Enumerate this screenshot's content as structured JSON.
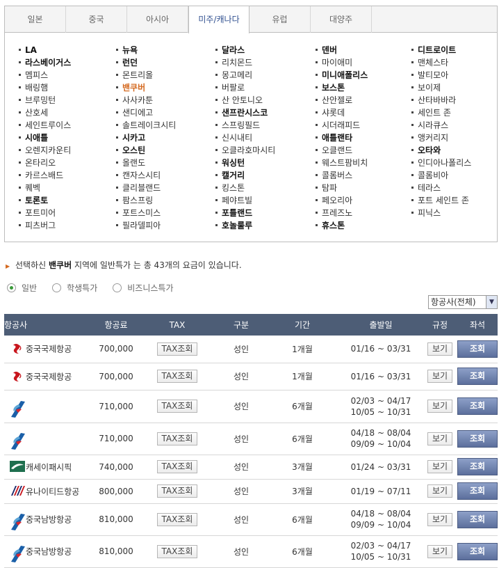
{
  "tabs": [
    {
      "label": "일본"
    },
    {
      "label": "중국"
    },
    {
      "label": "아시아"
    },
    {
      "label": "미주/캐나다"
    },
    {
      "label": "유럽"
    },
    {
      "label": "대양주"
    }
  ],
  "active_tab": 3,
  "city_columns": [
    [
      {
        "name": "LA",
        "style": "bold"
      },
      {
        "name": "라스베이거스",
        "style": "bold"
      },
      {
        "name": "멤피스",
        "style": ""
      },
      {
        "name": "배링햄",
        "style": ""
      },
      {
        "name": "브루밍턴",
        "style": ""
      },
      {
        "name": "산호세",
        "style": ""
      },
      {
        "name": "세인트루이스",
        "style": ""
      },
      {
        "name": "시애틀",
        "style": "bold"
      },
      {
        "name": "오렌지카운티",
        "style": ""
      },
      {
        "name": "온타리오",
        "style": ""
      },
      {
        "name": "카르스배드",
        "style": ""
      },
      {
        "name": "퀘벡",
        "style": ""
      },
      {
        "name": "토론토",
        "style": "bold"
      },
      {
        "name": "포트미어",
        "style": ""
      },
      {
        "name": "피츠버그",
        "style": ""
      }
    ],
    [
      {
        "name": "뉴욕",
        "style": "bold"
      },
      {
        "name": "런던",
        "style": "bold"
      },
      {
        "name": "몬트리올",
        "style": ""
      },
      {
        "name": "밴쿠버",
        "style": "sel"
      },
      {
        "name": "사사카툰",
        "style": ""
      },
      {
        "name": "샌디에고",
        "style": ""
      },
      {
        "name": "솔트레이크시티",
        "style": ""
      },
      {
        "name": "시카고",
        "style": "bold"
      },
      {
        "name": "오스틴",
        "style": "bold"
      },
      {
        "name": "올랜도",
        "style": ""
      },
      {
        "name": "캔자스시티",
        "style": ""
      },
      {
        "name": "클리블랜드",
        "style": ""
      },
      {
        "name": "팜스프링",
        "style": ""
      },
      {
        "name": "포트스미스",
        "style": ""
      },
      {
        "name": "필라델피아",
        "style": ""
      }
    ],
    [
      {
        "name": "달라스",
        "style": "bold"
      },
      {
        "name": "리치몬드",
        "style": ""
      },
      {
        "name": "몽고메리",
        "style": ""
      },
      {
        "name": "버팔로",
        "style": ""
      },
      {
        "name": "산 안토니오",
        "style": ""
      },
      {
        "name": "샌프란시스코",
        "style": "bold"
      },
      {
        "name": "스프링필드",
        "style": ""
      },
      {
        "name": "신시내티",
        "style": ""
      },
      {
        "name": "오클라호마시티",
        "style": ""
      },
      {
        "name": "워싱턴",
        "style": "bold"
      },
      {
        "name": "캘거리",
        "style": "bold"
      },
      {
        "name": "킹스톤",
        "style": ""
      },
      {
        "name": "페야트빌",
        "style": ""
      },
      {
        "name": "포틀랜드",
        "style": "bold"
      },
      {
        "name": "호놀룰루",
        "style": "bold"
      }
    ],
    [
      {
        "name": "덴버",
        "style": "bold"
      },
      {
        "name": "마이애미",
        "style": ""
      },
      {
        "name": "미니애폴리스",
        "style": "bold"
      },
      {
        "name": "보스톤",
        "style": "bold"
      },
      {
        "name": "산안젤로",
        "style": ""
      },
      {
        "name": "샤롯데",
        "style": ""
      },
      {
        "name": "시더래피드",
        "style": ""
      },
      {
        "name": "애틀랜타",
        "style": "bold"
      },
      {
        "name": "오클랜드",
        "style": ""
      },
      {
        "name": "웨스트팜비치",
        "style": ""
      },
      {
        "name": "콜롬버스",
        "style": ""
      },
      {
        "name": "탐파",
        "style": ""
      },
      {
        "name": "페오리아",
        "style": ""
      },
      {
        "name": "프레즈노",
        "style": ""
      },
      {
        "name": "휴스톤",
        "style": "bold"
      }
    ],
    [
      {
        "name": "디트로이트",
        "style": "bold"
      },
      {
        "name": "맨체스타",
        "style": ""
      },
      {
        "name": "발티모아",
        "style": ""
      },
      {
        "name": "보이제",
        "style": ""
      },
      {
        "name": "산타바바라",
        "style": ""
      },
      {
        "name": "세인트 존",
        "style": ""
      },
      {
        "name": "시라큐스",
        "style": ""
      },
      {
        "name": "앵커리지",
        "style": ""
      },
      {
        "name": "오타와",
        "style": "bold"
      },
      {
        "name": "인디아나폴리스",
        "style": ""
      },
      {
        "name": "콜롬비아",
        "style": ""
      },
      {
        "name": "테라스",
        "style": ""
      },
      {
        "name": "포트 세인트 존",
        "style": ""
      },
      {
        "name": "피닉스",
        "style": ""
      }
    ]
  ],
  "info": {
    "prefix": "선택하신",
    "city": "밴쿠버",
    "suffix": "지역에 일반특가 는 총 43개의 요금이 있습니다."
  },
  "fare_types": [
    {
      "label": "일반",
      "selected": true
    },
    {
      "label": "학생특가",
      "selected": false
    },
    {
      "label": "비즈니스특가",
      "selected": false
    }
  ],
  "airline_filter": {
    "value": "항공사(전체)"
  },
  "table": {
    "headers": [
      "항공사",
      "항공료",
      "TAX",
      "구분",
      "기간",
      "출발일",
      "규정",
      "좌석"
    ],
    "tax_button": "TAX조회",
    "rule_button": "보기",
    "seat_button": "조회",
    "rows": [
      {
        "logo": "air-china-logo",
        "airline": "중국국제항공",
        "fare": "700,000",
        "type": "성인",
        "period": "1개월",
        "dates": [
          "01/16 ~ 03/31"
        ]
      },
      {
        "logo": "air-china-logo",
        "airline": "중국국제항공",
        "fare": "700,000",
        "type": "성인",
        "period": "1개월",
        "dates": [
          "01/16 ~ 03/31"
        ]
      },
      {
        "logo": "china-southern-logo",
        "airline": "",
        "fare": "710,000",
        "type": "성인",
        "period": "6개월",
        "dates": [
          "02/03 ~ 04/17",
          "10/05 ~ 10/31"
        ]
      },
      {
        "logo": "china-southern-logo",
        "airline": "",
        "fare": "710,000",
        "type": "성인",
        "period": "6개월",
        "dates": [
          "04/18 ~ 08/04",
          "09/09 ~ 10/04"
        ]
      },
      {
        "logo": "cathay-pacific-logo",
        "airline": "캐세이패시픽",
        "fare": "740,000",
        "type": "성인",
        "period": "3개월",
        "dates": [
          "01/24 ~ 03/31"
        ]
      },
      {
        "logo": "united-airlines-logo",
        "airline": "유나이티드항공",
        "fare": "800,000",
        "type": "성인",
        "period": "3개월",
        "dates": [
          "01/19 ~ 07/11"
        ]
      },
      {
        "logo": "china-southern-logo",
        "airline": "중국남방항공",
        "fare": "810,000",
        "type": "성인",
        "period": "6개월",
        "dates": [
          "04/18 ~ 08/04",
          "09/09 ~ 10/04"
        ]
      },
      {
        "logo": "china-southern-logo",
        "airline": "중국남방항공",
        "fare": "810,000",
        "type": "성인",
        "period": "6개월",
        "dates": [
          "02/03 ~ 04/17",
          "10/05 ~ 10/31"
        ]
      }
    ]
  },
  "colors": {
    "accent_orange": "#d4691f",
    "table_header": "#4d5d76",
    "seat_button": "#6a7daa"
  }
}
